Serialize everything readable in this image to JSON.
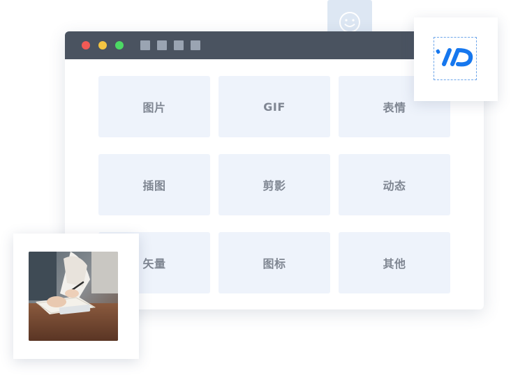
{
  "window": {
    "title_dots": [
      "red",
      "yellow",
      "green"
    ],
    "toolbar_squares": 4
  },
  "categories": [
    {
      "label": "图片"
    },
    {
      "label": "GIF"
    },
    {
      "label": "表情"
    },
    {
      "label": "插图"
    },
    {
      "label": "剪影"
    },
    {
      "label": "动态"
    },
    {
      "label": "矢量"
    },
    {
      "label": "图标"
    },
    {
      "label": "其他"
    }
  ],
  "icons": {
    "smiley": "smiley-icon",
    "logo": "brand-logo-icon",
    "photo": "photo-thumbnail"
  },
  "colors": {
    "titlebar": "#4a5360",
    "tile_bg": "#eef3fb",
    "tile_text": "#7f8692",
    "logo_blue": "#1677ee"
  }
}
